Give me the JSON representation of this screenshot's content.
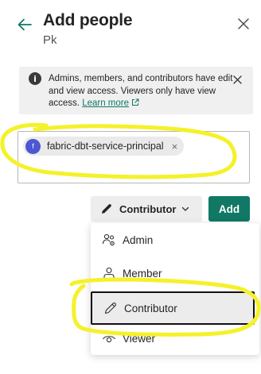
{
  "dialog": {
    "title": "Add people",
    "subtitle": "Pk",
    "back_icon": "arrow-left-icon",
    "close_icon": "close-icon"
  },
  "info": {
    "text": "Admins, members, and contributors have edit and view access. Viewers only have view access.",
    "link": "Learn more",
    "icon": "info-icon"
  },
  "people": {
    "chips": [
      {
        "initial": "f",
        "label": "fabric-dbt-service-principal",
        "remove": "×"
      }
    ]
  },
  "role_button": {
    "label": "Contributor",
    "icon": "pencil-icon"
  },
  "add_button": {
    "label": "Add"
  },
  "role_menu": {
    "items": [
      {
        "label": "Admin",
        "icon": "admin-people-icon"
      },
      {
        "label": "Member",
        "icon": "person-icon"
      },
      {
        "label": "Contributor",
        "icon": "pencil-icon",
        "selected": true
      },
      {
        "label": "Viewer",
        "icon": "eye-icon"
      }
    ]
  },
  "colors": {
    "accent": "#117865",
    "highlight": "#f5f12a",
    "avatar": "#4b57d3"
  }
}
